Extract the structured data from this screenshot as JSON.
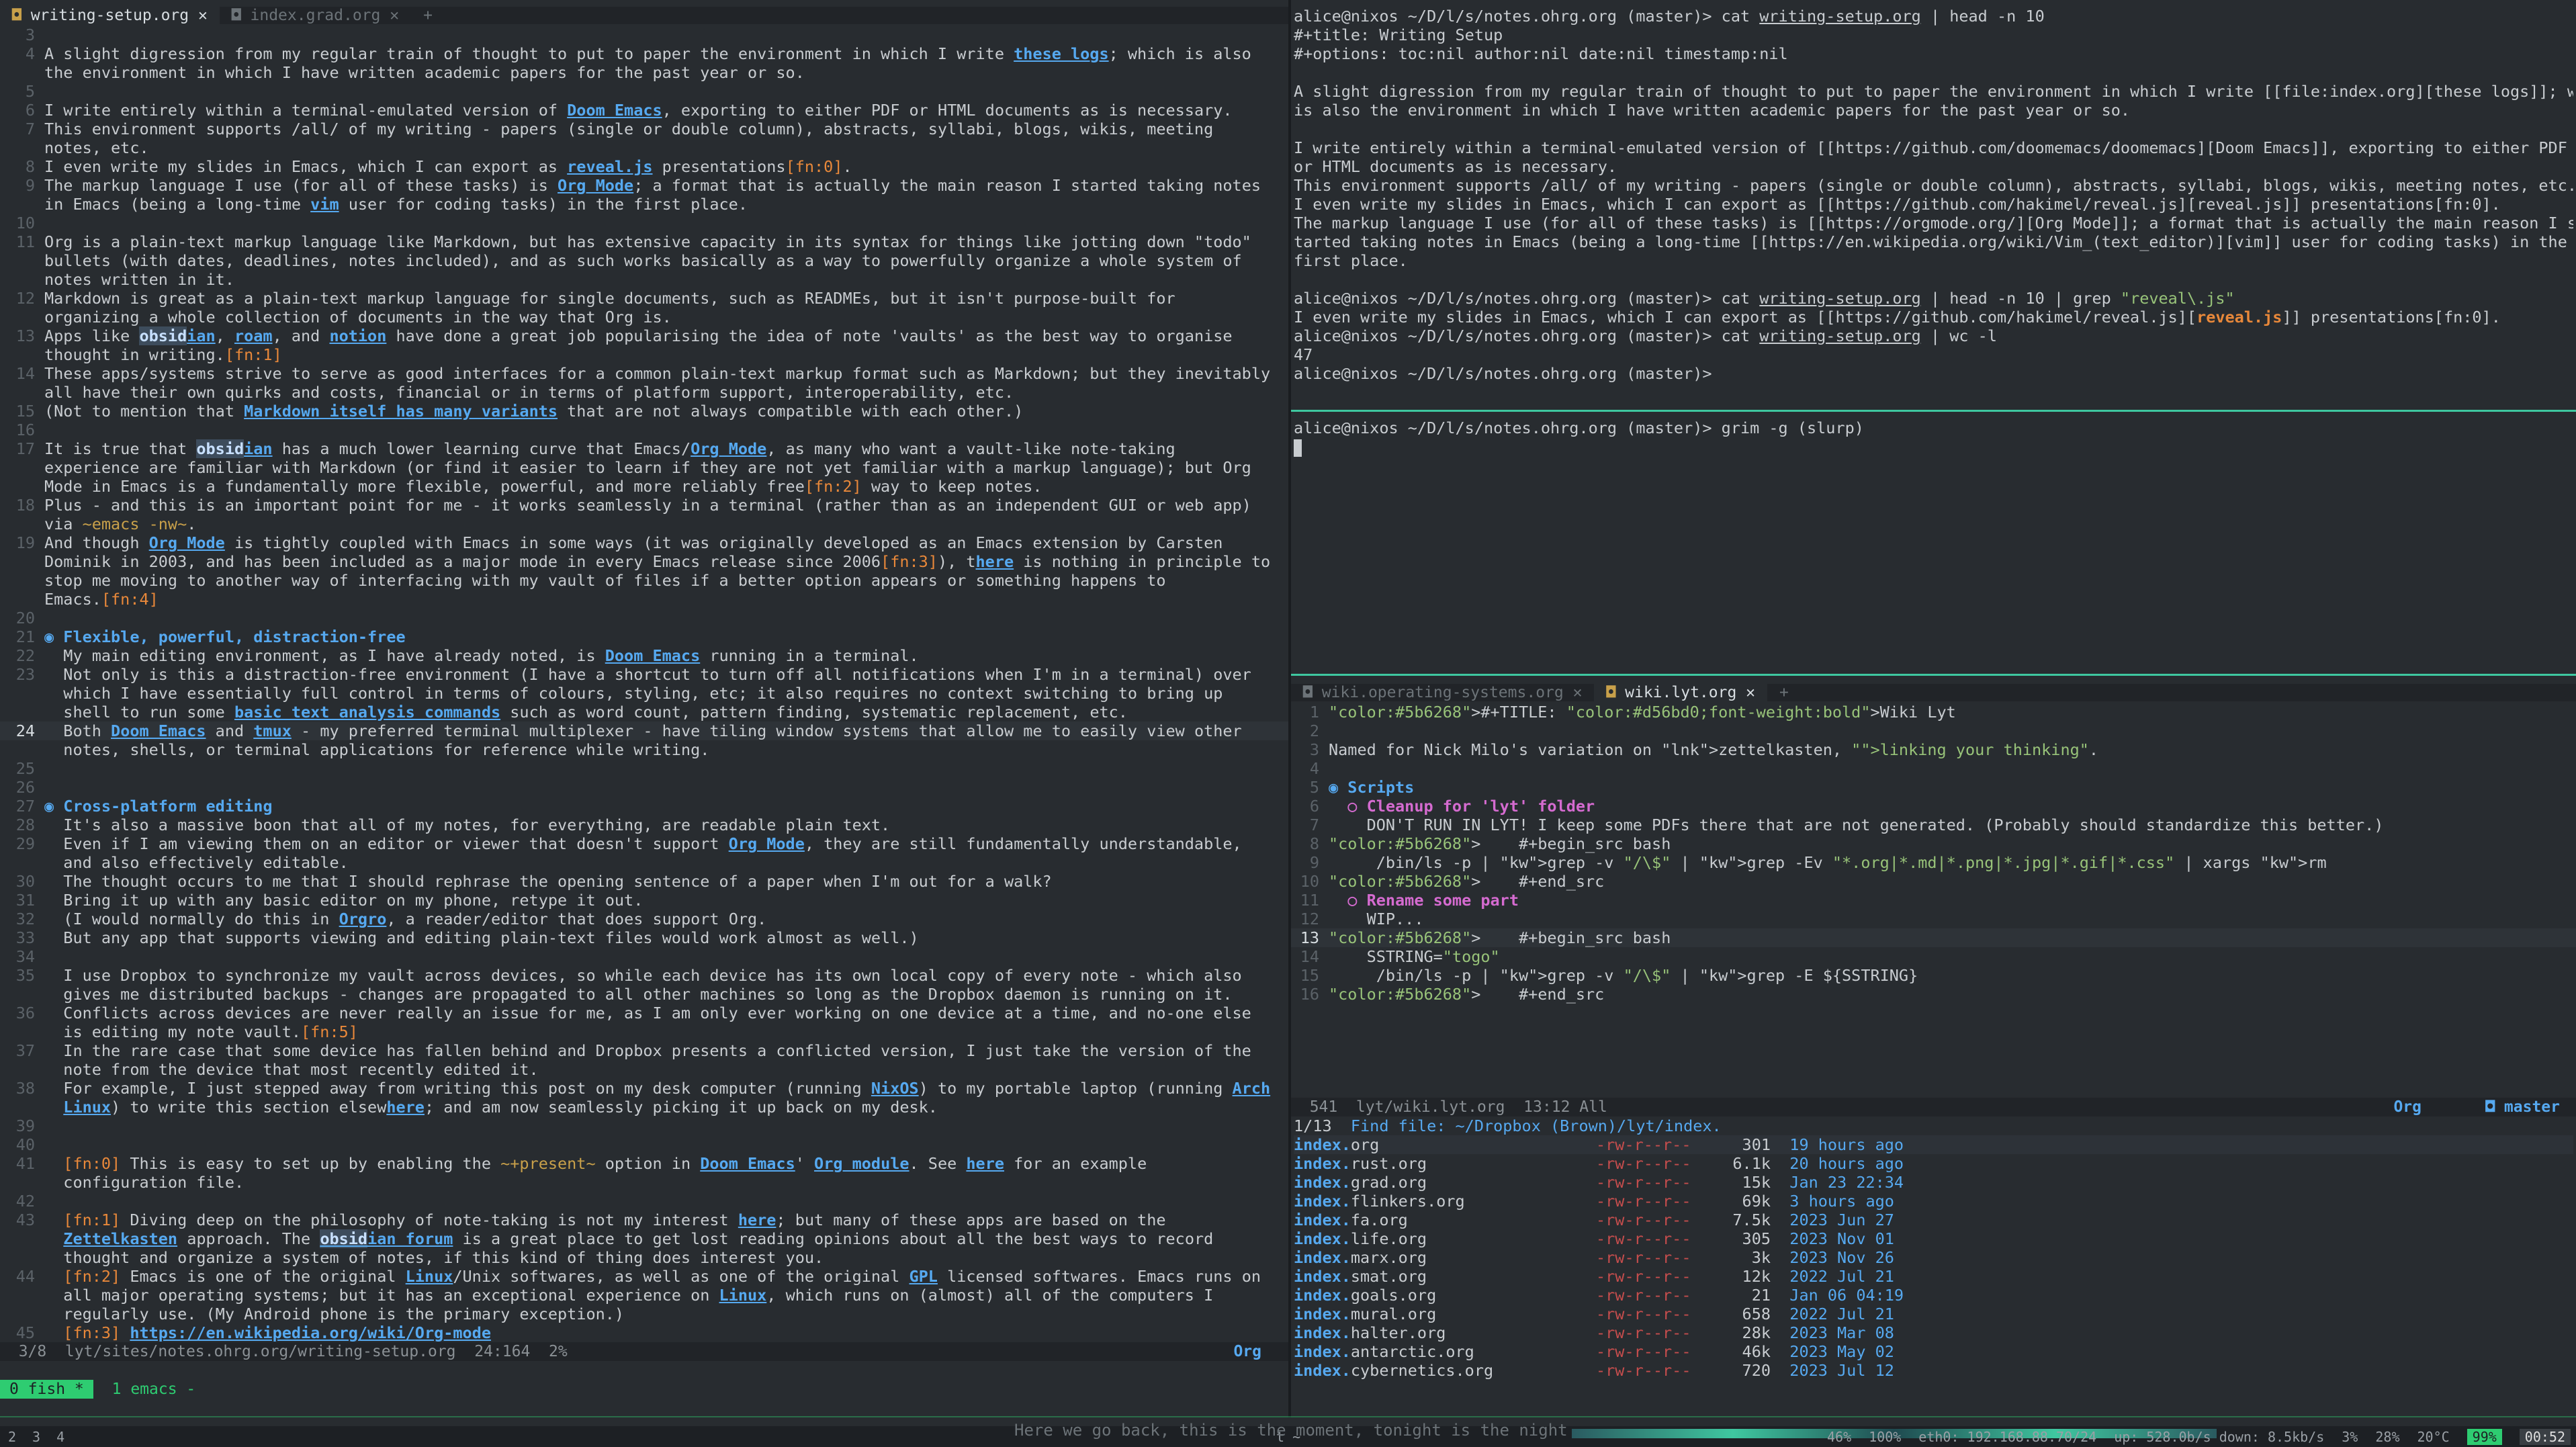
{
  "left_tabs": [
    "writing-setup.org",
    "index.grad.org",
    "+"
  ],
  "left_lines": [
    {
      "n": "3",
      "t": ""
    },
    {
      "n": "4",
      "t": "A slight digression from my regular train of thought to put to paper the environment in which I write these logs; which is also"
    },
    {
      "n": "",
      "t": "the environment in which I have written academic papers for the past year or so."
    },
    {
      "n": "5",
      "t": ""
    },
    {
      "n": "6",
      "t": "I write entirely within a terminal-emulated version of Doom Emacs, exporting to either PDF or HTML documents as is necessary."
    },
    {
      "n": "7",
      "t": "This environment supports /all/ of my writing - papers (single or double column), abstracts, syllabi, blogs, wikis, meeting"
    },
    {
      "n": "",
      "t": "notes, etc."
    },
    {
      "n": "8",
      "t": "I even write my slides in Emacs, which I can export as reveal.js presentations[fn:0]."
    },
    {
      "n": "9",
      "t": "The markup language I use (for all of these tasks) is Org Mode; a format that is actually the main reason I started taking notes"
    },
    {
      "n": "",
      "t": "in Emacs (being a long-time vim user for coding tasks) in the first place."
    },
    {
      "n": "10",
      "t": ""
    },
    {
      "n": "11",
      "t": "Org is a plain-text markup language like Markdown, but has extensive capacity in its syntax for things like jotting down \"todo\""
    },
    {
      "n": "",
      "t": "bullets (with dates, deadlines, notes included), and as such works basically as a way to powerfully organize a whole system of"
    },
    {
      "n": "",
      "t": "notes written in it."
    },
    {
      "n": "12",
      "t": "Markdown is great as a plain-text markup language for single documents, such as READMEs, but it isn't purpose-built for"
    },
    {
      "n": "",
      "t": "organizing a whole collection of documents in the way that Org is."
    },
    {
      "n": "13",
      "t": "Apps like obsidian, roam, and notion have done a great job popularising the idea of note 'vaults' as the best way to organise"
    },
    {
      "n": "",
      "t": "thought in writing.[fn:1]"
    },
    {
      "n": "14",
      "t": "These apps/systems strive to serve as good interfaces for a common plain-text markup format such as Markdown; but they inevitably"
    },
    {
      "n": "",
      "t": "all have their own quirks and costs, financial or in terms of platform support, interoperability, etc."
    },
    {
      "n": "15",
      "t": "(Not to mention that Markdown itself has many variants that are not always compatible with each other.)"
    },
    {
      "n": "16",
      "t": ""
    },
    {
      "n": "17",
      "t": "It is true that obsidian has a much lower learning curve that Emacs/Org Mode, as many who want a vault-like note-taking"
    },
    {
      "n": "",
      "t": "experience are familiar with Markdown (or find it easier to learn if they are not yet familiar with a markup language); but Org"
    },
    {
      "n": "",
      "t": "Mode in Emacs is a fundamentally more flexible, powerful, and more reliably free[fn:2] way to keep notes."
    },
    {
      "n": "18",
      "t": "Plus - and this is an important point for me - it works seamlessly in a terminal (rather than as an independent GUI or web app)"
    },
    {
      "n": "",
      "t": "via ~emacs -nw~."
    },
    {
      "n": "19",
      "t": "And though Org Mode is tightly coupled with Emacs in some ways (it was originally developed as an Emacs extension by Carsten"
    },
    {
      "n": "",
      "t": "Dominik in 2003, and has been included as a major mode in every Emacs release since 2006[fn:3]), there is nothing in principle to"
    },
    {
      "n": "",
      "t": "stop me moving to another way of interfacing with my vault of files if a better option appears or something happens to"
    },
    {
      "n": "",
      "t": "Emacs.[fn:4]"
    },
    {
      "n": "20",
      "t": ""
    },
    {
      "n": "21",
      "t": "◉ Flexible, powerful, distraction-free"
    },
    {
      "n": "22",
      "t": "  My main editing environment, as I have already noted, is Doom Emacs running in a terminal."
    },
    {
      "n": "23",
      "t": "  Not only is this a distraction-free environment (I have a shortcut to turn off all notifications when I'm in a terminal) over"
    },
    {
      "n": "",
      "t": "  which I have essentially full control in terms of colours, styling, etc; it also requires no context switching to bring up"
    },
    {
      "n": "",
      "t": "  shell to run some basic text analysis commands such as word count, pattern finding, systematic replacement, etc."
    },
    {
      "n": "24",
      "t": "  Both Doom Emacs and tmux - my preferred terminal multiplexer - have tiling window systems that allow me to easily view other"
    },
    {
      "n": "",
      "t": "  notes, shells, or terminal applications for reference while writing."
    },
    {
      "n": "25",
      "t": ""
    },
    {
      "n": "26",
      "t": ""
    },
    {
      "n": "27",
      "t": "◉ Cross-platform editing"
    },
    {
      "n": "28",
      "t": "  It's also a massive boon that all of my notes, for everything, are readable plain text."
    },
    {
      "n": "29",
      "t": "  Even if I am viewing them on an editor or viewer that doesn't support Org Mode, they are still fundamentally understandable,"
    },
    {
      "n": "",
      "t": "  and also effectively editable."
    },
    {
      "n": "30",
      "t": "  The thought occurs to me that I should rephrase the opening sentence of a paper when I'm out for a walk?"
    },
    {
      "n": "31",
      "t": "  Bring it up with any basic editor on my phone, retype it out."
    },
    {
      "n": "32",
      "t": "  (I would normally do this in Orgro, a reader/editor that does support Org."
    },
    {
      "n": "33",
      "t": "  But any app that supports viewing and editing plain-text files would work almost as well.)"
    },
    {
      "n": "34",
      "t": ""
    },
    {
      "n": "35",
      "t": "  I use Dropbox to synchronize my vault across devices, so while each device has its own local copy of every note - which also"
    },
    {
      "n": "",
      "t": "  gives me distributed backups - changes are propagated to all other machines so long as the Dropbox daemon is running on it."
    },
    {
      "n": "36",
      "t": "  Conflicts across devices are never really an issue for me, as I am only ever working on one device at a time, and no-one else"
    },
    {
      "n": "",
      "t": "  is editing my note vault.[fn:5]"
    },
    {
      "n": "37",
      "t": "  In the rare case that some device has fallen behind and Dropbox presents a conflicted version, I just take the version of the"
    },
    {
      "n": "",
      "t": "  note from the device that most recently edited it."
    },
    {
      "n": "38",
      "t": "  For example, I just stepped away from writing this post on my desk computer (running NixOS) to my portable laptop (running Arch"
    },
    {
      "n": "",
      "t": "  Linux) to write this section elsewhere; and am now seamlessly picking it up back on my desk."
    },
    {
      "n": "39",
      "t": ""
    },
    {
      "n": "40",
      "t": ""
    },
    {
      "n": "41",
      "t": "  [fn:0] This is easy to set up by enabling the ~+present~ option in Doom Emacs' Org module. See here for an example"
    },
    {
      "n": "",
      "t": "  configuration file."
    },
    {
      "n": "42",
      "t": ""
    },
    {
      "n": "43",
      "t": "  [fn:1] Diving deep on the philosophy of note-taking is not my interest here; but many of these apps are based on the"
    },
    {
      "n": "",
      "t": "  Zettelkasten approach. The obsidian forum is a great place to get lost reading opinions about all the best ways to record"
    },
    {
      "n": "",
      "t": "  thought and organize a system of notes, if this kind of thing does interest you."
    },
    {
      "n": "44",
      "t": "  [fn:2] Emacs is one of the original Linux/Unix softwares, as well as one of the original GPL licensed softwares. Emacs runs on"
    },
    {
      "n": "",
      "t": "  all major operating systems; but it has an exceptional experience on Linux, which runs on (almost) all of the computers I"
    },
    {
      "n": "",
      "t": "  regularly use. (My Android phone is the primary exception.)"
    },
    {
      "n": "45",
      "t": "  [fn:3] https://en.wikipedia.org/wiki/Org-mode"
    }
  ],
  "left_modeline": "  3/8  lyt/sites/notes.ohrg.org/writing-setup.org  24:164  2%",
  "left_modeline_mode": "Org",
  "term_lines": [
    "alice@nixos ~/D/l/s/notes.ohrg.org (master)> cat writing-setup.org | head -n 10",
    "#+title: Writing Setup",
    "#+options: toc:nil author:nil date:nil timestamp:nil",
    "",
    "A slight digression from my regular train of thought to put to paper the environment in which I write [[file:index.org][these logs]]; which",
    "is also the environment in which I have written academic papers for the past year or so.",
    "",
    "I write entirely within a terminal-emulated version of [[https://github.com/doomemacs/doomemacs][Doom Emacs]], exporting to either PDF",
    "or HTML documents as is necessary.",
    "This environment supports /all/ of my writing - papers (single or double column), abstracts, syllabi, blogs, wikis, meeting notes, etc.",
    "I even write my slides in Emacs, which I can export as [[https://github.com/hakimel/reveal.js][reveal.js]] presentations[fn:0].",
    "The markup language I use (for all of these tasks) is [[https://orgmode.org/][Org Mode]]; a format that is actually the main reason I s",
    "tarted taking notes in Emacs (being a long-time [[https://en.wikipedia.org/wiki/Vim_(text_editor)][vim]] user for coding tasks) in the",
    "first place.",
    "",
    "alice@nixos ~/D/l/s/notes.ohrg.org (master)> cat writing-setup.org | head -n 10 | grep \"reveal\\.js\"",
    "I even write my slides in Emacs, which I can export as [[https://github.com/hakimel/reveal.js][reveal.js]] presentations[fn:0].",
    "alice@nixos ~/D/l/s/notes.ohrg.org (master)> cat writing-setup.org | wc -l",
    "47",
    "alice@nixos ~/D/l/s/notes.ohrg.org (master)>"
  ],
  "term2_line": "alice@nixos ~/D/l/s/notes.ohrg.org (master)> grim -g (slurp)",
  "right_tabs": [
    "wiki.operating-systems.org",
    "wiki.lyt.org",
    "+"
  ],
  "right_lines": [
    {
      "n": "1",
      "t": "#+TITLE: Wiki Lyt"
    },
    {
      "n": "2",
      "t": ""
    },
    {
      "n": "3",
      "t": "Named for Nick Milo's variation on zettelkasten, \"linking your thinking\"."
    },
    {
      "n": "4",
      "t": ""
    },
    {
      "n": "5",
      "t": "◉ Scripts"
    },
    {
      "n": "6",
      "t": "  ○ Cleanup for 'lyt' folder"
    },
    {
      "n": "7",
      "t": "    DON'T RUN IN LYT! I keep some PDFs there that are not generated. (Probably should standardize this better.)"
    },
    {
      "n": "8",
      "t": "    #+begin_src bash"
    },
    {
      "n": "9",
      "t": "     /bin/ls -p | grep -v \"/\\$\" | grep -Ev \"*.org|*.md|*.png|*.jpg|*.gif|*.css\" | xargs rm"
    },
    {
      "n": "10",
      "t": "    #+end_src"
    },
    {
      "n": "11",
      "t": "  ○ Rename some part"
    },
    {
      "n": "12",
      "t": "    WIP..."
    },
    {
      "n": "13",
      "t": "    #+begin_src bash"
    },
    {
      "n": "14",
      "t": "    SSTRING=\"togo\""
    },
    {
      "n": "15",
      "t": "     /bin/ls -p | grep -v \"/\\$\" | grep -E ${SSTRING}"
    },
    {
      "n": "16",
      "t": "    #+end_src"
    }
  ],
  "right_modeline": "  541  lyt/wiki.lyt.org  13:12 All",
  "right_modeline_mode": "Org",
  "right_modeline_branch": "master",
  "findfile": {
    "count": "1/13",
    "prompt": "Find file: ~/Dropbox (Brown)/lyt/index.",
    "files": [
      {
        "name": "index.org",
        "perm": "-rw-r--r--",
        "size": "301",
        "time": "19 hours ago"
      },
      {
        "name": "index.rust.org",
        "perm": "-rw-r--r--",
        "size": "6.1k",
        "time": "20 hours ago"
      },
      {
        "name": "index.grad.org",
        "perm": "-rw-r--r--",
        "size": "15k",
        "time": "Jan 23 22:34"
      },
      {
        "name": "index.flinkers.org",
        "perm": "-rw-r--r--",
        "size": "69k",
        "time": "3 hours ago"
      },
      {
        "name": "index.fa.org",
        "perm": "-rw-r--r--",
        "size": "7.5k",
        "time": "2023 Jun 27"
      },
      {
        "name": "index.life.org",
        "perm": "-rw-r--r--",
        "size": "305",
        "time": "2023 Nov 01"
      },
      {
        "name": "index.marx.org",
        "perm": "-rw-r--r--",
        "size": "3k",
        "time": "2023 Nov 26"
      },
      {
        "name": "index.smat.org",
        "perm": "-rw-r--r--",
        "size": "12k",
        "time": "2022 Jul 21"
      },
      {
        "name": "index.goals.org",
        "perm": "-rw-r--r--",
        "size": "21",
        "time": "Jan 06 04:19"
      },
      {
        "name": "index.mural.org",
        "perm": "-rw-r--r--",
        "size": "658",
        "time": "2022 Jul 21"
      },
      {
        "name": "index.halter.org",
        "perm": "-rw-r--r--",
        "size": "28k",
        "time": "2023 Mar 08"
      },
      {
        "name": "index.antarctic.org",
        "perm": "-rw-r--r--",
        "size": "46k",
        "time": "2023 May 02"
      },
      {
        "name": "index.cybernetics.org",
        "perm": "-rw-r--r--",
        "size": "720",
        "time": "2023 Jul 12"
      }
    ]
  },
  "tmux": {
    "active": "0 fish *",
    "other": "1 emacs -"
  },
  "statusbar": {
    "workspaces": [
      "2",
      "3",
      "4"
    ],
    "title": "t ~",
    "song": "Here we go back, this is the moment, tonight is the night",
    "items": [
      "46%",
      "100%",
      "eth0: 192.168.88.70/24",
      "up: 528.0b/s down: 8.5kb/s",
      "3%",
      "28%",
      "20°C",
      "99%",
      "00:52"
    ]
  }
}
